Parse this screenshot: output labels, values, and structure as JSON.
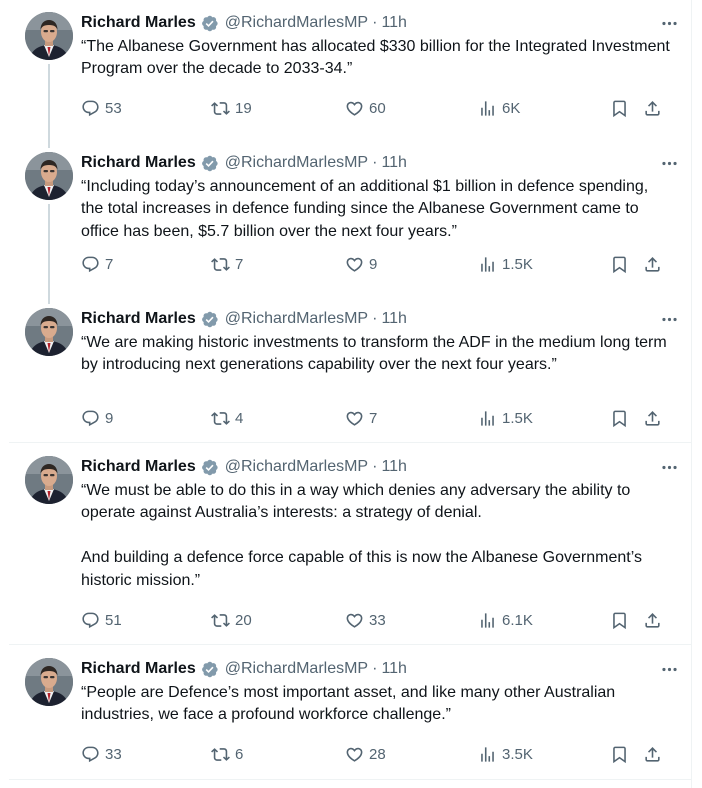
{
  "author": {
    "name": "Richard Marles",
    "handle": "@RichardMarlesMP",
    "separator": "·",
    "time": "11h"
  },
  "icons": {
    "verified": "verified-badge-icon",
    "more": "more-dots-icon",
    "reply": "reply-bubble-icon",
    "retweet": "retweet-arrows-icon",
    "like": "heart-icon",
    "views": "views-bar-chart-icon",
    "bookmark": "bookmark-icon",
    "share": "share-upload-icon"
  },
  "colors": {
    "text": "#0f1419",
    "muted": "#536471",
    "thread_line": "#cfd9de",
    "verified": "#829aab",
    "divider": "#eff3f4"
  },
  "tweets": [
    {
      "text": "“The Albanese Government has allocated $330 billion for the Integrated Investment Program over the decade to 2033-34.”",
      "replies": "53",
      "retweets": "19",
      "likes": "60",
      "views": "6K"
    },
    {
      "text": "“Including today’s announcement of an additional $1 billion in defence spending, the total increases in defence funding since the Albanese Government came to office has been, $5.7 billion over the next four years.”",
      "replies": "7",
      "retweets": "7",
      "likes": "9",
      "views": "1.5K"
    },
    {
      "text": "“We are making historic investments to transform the ADF in the medium long term by introducing next generations capability over the next four years.”",
      "replies": "9",
      "retweets": "4",
      "likes": "7",
      "views": "1.5K"
    },
    {
      "text": "“We must be able to do this in a way which denies any adversary the ability to operate against Australia’s interests: a strategy of denial.\n\nAnd building a defence force capable of this is now the Albanese Government’s historic mission.”",
      "replies": "51",
      "retweets": "20",
      "likes": "33",
      "views": "6.1K"
    },
    {
      "text": "“People are Defence’s most important asset, and like many other Australian industries, we face a profound workforce challenge.”",
      "replies": "33",
      "retweets": "6",
      "likes": "28",
      "views": "3.5K"
    }
  ]
}
